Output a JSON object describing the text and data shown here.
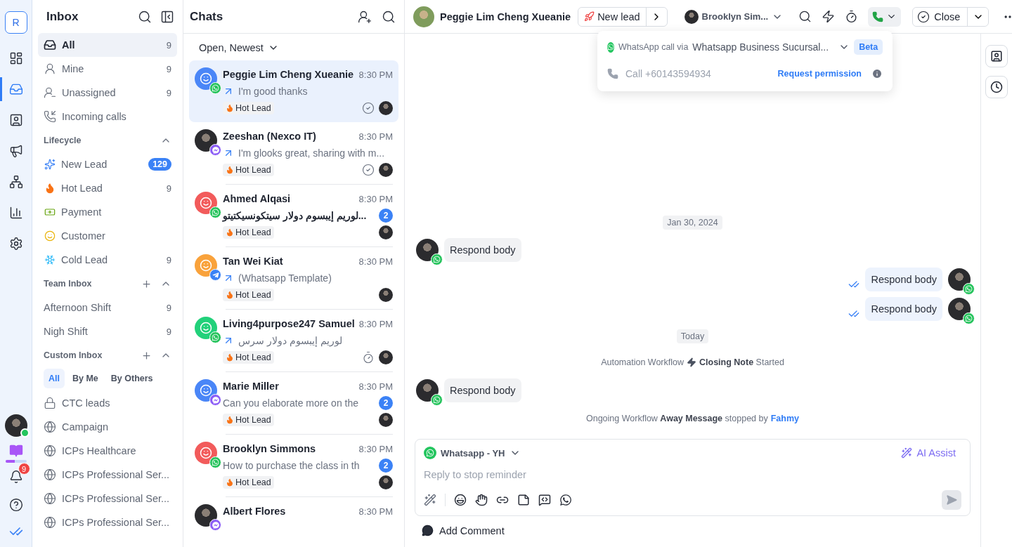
{
  "rail": {
    "logo": "R",
    "items": [
      {
        "kind": "layout",
        "selected": false
      },
      {
        "kind": "inbox",
        "selected": true
      },
      {
        "kind": "contacts",
        "selected": false
      },
      {
        "kind": "broadcast",
        "selected": false
      },
      {
        "kind": "workflow",
        "selected": false
      },
      {
        "kind": "reports",
        "selected": false
      },
      {
        "kind": "settings",
        "selected": false
      }
    ],
    "user_online": true,
    "notifications": "9"
  },
  "inbox": {
    "title": "Inbox",
    "items": [
      {
        "kind": "inbox",
        "label": "All",
        "count": "9",
        "selected": true
      },
      {
        "kind": "mine",
        "label": "Mine",
        "count": "9",
        "selected": false
      },
      {
        "kind": "unassigned",
        "label": "Unassigned",
        "count": "9",
        "selected": false
      },
      {
        "kind": "calls",
        "label": "Incoming calls",
        "selected": false
      }
    ],
    "sections": [
      {
        "title": "Lifecycle",
        "expanded": true,
        "addable": false,
        "items": [
          {
            "kind": "new",
            "label": "New Lead",
            "count": "129",
            "highlight": true
          },
          {
            "kind": "fire",
            "label": "Hot Lead",
            "count": "9",
            "highlight": false
          },
          {
            "kind": "money",
            "label": "Payment"
          },
          {
            "kind": "starry",
            "label": "Customer"
          },
          {
            "kind": "ice",
            "label": "Cold Lead",
            "count": "9",
            "highlight": false
          }
        ]
      },
      {
        "title": "Team Inbox",
        "expanded": true,
        "addable": true,
        "items": [
          {
            "label": "Afternoon Shift",
            "count": "9"
          },
          {
            "label": "Nigh Shift",
            "count": "9"
          }
        ]
      },
      {
        "title": "Custom Inbox",
        "expanded": true,
        "addable": true,
        "filters": [
          {
            "label": "All",
            "selected": true
          },
          {
            "label": "By Me",
            "selected": false
          },
          {
            "label": "By Others",
            "selected": false
          }
        ],
        "items": [
          {
            "kind": "lock",
            "label": "CTC leads"
          },
          {
            "kind": "globe",
            "label": "Campaign"
          },
          {
            "kind": "globe",
            "label": "ICPs Healthcare"
          },
          {
            "kind": "globe",
            "label": "ICPs Professional Ser..."
          },
          {
            "kind": "globe",
            "label": "ICPs Professional Ser..."
          },
          {
            "kind": "globe",
            "label": "ICPs Professional Ser..."
          }
        ]
      }
    ]
  },
  "chats": {
    "title": "Chats",
    "filter": "Open, Newest",
    "items": [
      {
        "name": "Peggie Lim Cheng Xueanie",
        "time": "8:30 PM",
        "preview": "I'm good thanks",
        "outgoing": true,
        "preview_bold": false,
        "tag": "Hot Lead",
        "channel": {
          "kind": "whatsapp"
        },
        "avatar": {
          "kind": "face",
          "color": "#4a86f7"
        },
        "status": {
          "kind": "resolved"
        },
        "selected": true
      },
      {
        "name": "Zeeshan (Nexco IT)",
        "time": "8:30 PM",
        "preview": "I'm glooks great, sharing with m...",
        "outgoing": true,
        "preview_bold": false,
        "tag": "Hot Lead",
        "channel": {
          "kind": "messenger"
        },
        "avatar": {
          "kind": "photo"
        },
        "status": {
          "kind": "resolved"
        },
        "selected": false
      },
      {
        "name": "Ahmed Alqasi",
        "time": "8:30 PM",
        "preview": "لوريم إيبسوم دولار سيتكونسيكتيتو...",
        "outgoing": false,
        "preview_bold": true,
        "tag": "Hot Lead",
        "channel": {
          "kind": "whatsapp"
        },
        "avatar": {
          "kind": "face",
          "color": "#f25b5b"
        },
        "unread": "2",
        "selected": false
      },
      {
        "name": "Tan Wei Kiat",
        "time": "8:30 PM",
        "preview": "(Whatsapp Template)",
        "outgoing": true,
        "preview_bold": false,
        "tag": "Hot Lead",
        "channel": {
          "kind": "telegram"
        },
        "avatar": {
          "kind": "face",
          "color": "#f9a23b"
        },
        "selected": false
      },
      {
        "name": "Living4purpose247 Samuel",
        "time": "8:30 PM",
        "preview": "لوريم إيبسوم دولار سرس",
        "outgoing": true,
        "preview_bold": false,
        "tag": "Hot Lead",
        "channel": {
          "kind": "whatsapp"
        },
        "avatar": {
          "kind": "face",
          "color": "#22d17a"
        },
        "status": {
          "kind": "snoozed"
        },
        "selected": false
      },
      {
        "name": "Marie Miller",
        "time": "8:30 PM",
        "preview": "Can you elaborate more on the",
        "outgoing": false,
        "preview_bold": false,
        "tag": "Hot Lead",
        "channel": {
          "kind": "messenger"
        },
        "avatar": {
          "kind": "face",
          "color": "#4a86f7"
        },
        "unread": "2",
        "selected": false
      },
      {
        "name": "Brooklyn Simmons",
        "time": "8:30 PM",
        "preview": "How to purchase the class in th",
        "outgoing": false,
        "preview_bold": false,
        "tag": "Hot Lead",
        "channel": {
          "kind": "whatsapp"
        },
        "avatar": {
          "kind": "face",
          "color": "#f25b5b"
        },
        "unread": "2",
        "selected": false
      },
      {
        "name": "Albert Flores",
        "time": "8:30 PM",
        "channel": {
          "kind": "messenger"
        },
        "avatar": {
          "kind": "photo"
        },
        "selected": false
      }
    ]
  },
  "conversation": {
    "contact": "Peggie Lim Cheng Xueanie",
    "stage": "New lead",
    "assignee": "Brooklyn Sim...",
    "close": "Close",
    "call_menu": {
      "via_label": "WhatsApp call via",
      "account": "Whatsapp Business Sucursal...",
      "badge": "Beta",
      "phone": "Call +60143594934",
      "action": "Request permission"
    },
    "messages": [
      {
        "kind": "date",
        "text": "Jan 30, 2024"
      },
      {
        "kind": "incoming",
        "text": "Respond body"
      },
      {
        "kind": "outgoing",
        "text": "Respond body"
      },
      {
        "kind": "outgoing",
        "text": "Respond body"
      },
      {
        "kind": "date",
        "text": "Today"
      },
      {
        "kind": "event",
        "lead": "Automation Workflow",
        "text": "**Closing Note** Started"
      },
      {
        "kind": "incoming",
        "text": "Respond body"
      },
      {
        "kind": "event",
        "text": "Ongoing Workflow **Away Message** stopped by",
        "link": "Fahmy"
      }
    ],
    "composer": {
      "channel": "Whatsapp - YH",
      "ai": "AI Assist",
      "placeholder": "Reply to stop reminder"
    },
    "comment": "Add Comment"
  }
}
